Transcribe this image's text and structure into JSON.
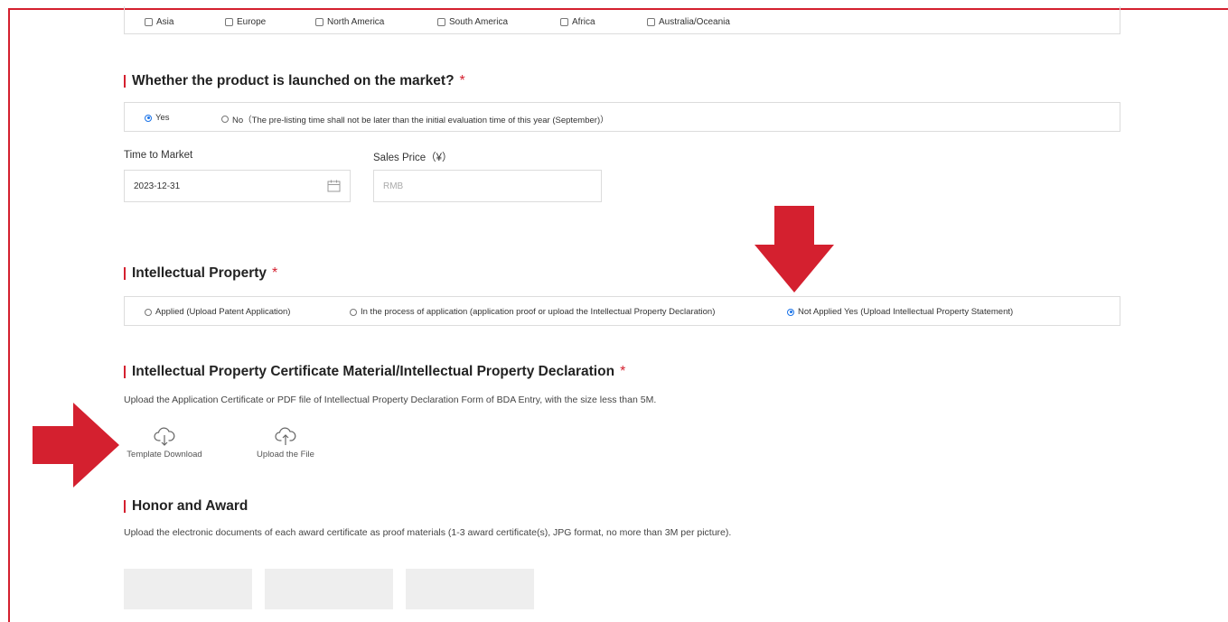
{
  "regions": {
    "items": [
      "Asia",
      "Europe",
      "North America",
      "South America",
      "Africa",
      "Australia/Oceania"
    ]
  },
  "market": {
    "title": "Whether the product is launched on the market?",
    "required_mark": "*",
    "options": [
      "Yes",
      "No（The pre-listing time shall not be later than the initial evaluation time of this year (September)）"
    ],
    "selected": "Yes",
    "time_label": "Time to Market",
    "time_value": "2023-12-31",
    "price_label": "Sales Price（¥）",
    "price_placeholder": "RMB"
  },
  "ip": {
    "title": "Intellectual Property",
    "required_mark": "*",
    "options": [
      "Applied (Upload Patent Application)",
      "In the process of application (application proof or upload the Intellectual Property Declaration)",
      "Not Applied Yes (Upload Intellectual Property Statement)"
    ],
    "selected": "Not Applied Yes (Upload Intellectual Property Statement)"
  },
  "certificate": {
    "title": "Intellectual Property Certificate Material/Intellectual Property Declaration",
    "required_mark": "*",
    "description": "Upload the Application Certificate or PDF file of Intellectual Property Declaration Form of BDA Entry, with the size less than 5M.",
    "template_download": "Template Download",
    "upload_file": "Upload the File"
  },
  "honor": {
    "title": "Honor and Award",
    "description": "Upload the electronic documents of each award certificate as proof materials (1-3 award certificate(s), JPG format, no more than 3M per picture)."
  },
  "icons": {
    "calendar": "calendar-icon",
    "download": "cloud-download-icon",
    "upload": "cloud-upload-icon",
    "arrow_down": "red-arrow-down-icon",
    "arrow_right": "red-arrow-right-icon"
  },
  "colors": {
    "accent": "#d4202f",
    "radio_selected": "#1a73e8",
    "border": "#dcdcdc",
    "placeholder_bg": "#eeeeee"
  }
}
